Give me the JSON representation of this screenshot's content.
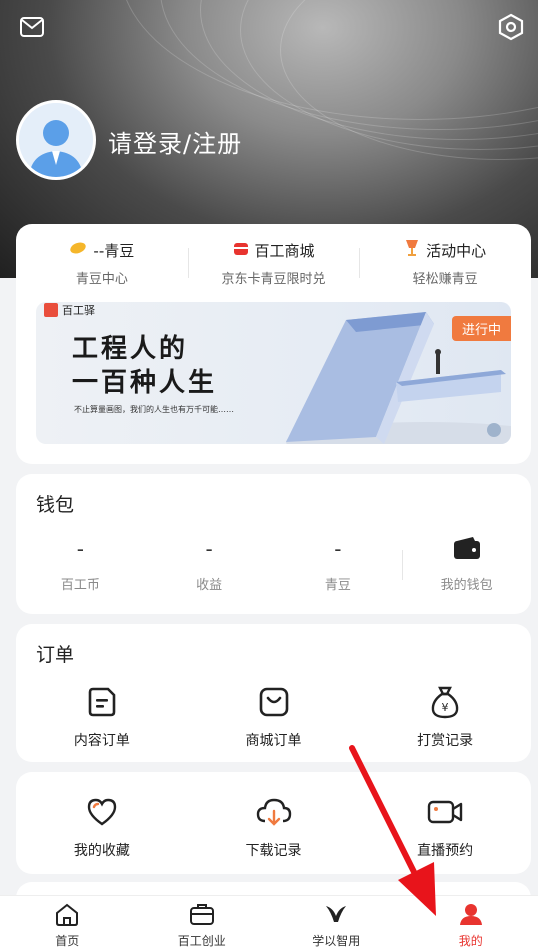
{
  "header": {
    "login_text": "请登录/注册",
    "left_icon": "mail-icon",
    "right_icon": "settings-hex-icon"
  },
  "stats": [
    {
      "title": "--青豆",
      "sub": "青豆中心",
      "icon": "bean-icon"
    },
    {
      "title": "百工商城",
      "sub": "京东卡青豆限时兑",
      "icon": "shop-icon"
    },
    {
      "title": "活动中心",
      "sub": "轻松赚青豆",
      "icon": "trophy-icon"
    }
  ],
  "banner": {
    "logo_text": "百工驿",
    "title_line1": "工程人的",
    "title_line2": "一百种人生",
    "subtitle": "不止算量画图，我们的人生也有万千可能……",
    "tag": "进行中"
  },
  "wallet": {
    "title": "钱包",
    "items": [
      {
        "value": "-",
        "label": "百工币"
      },
      {
        "value": "-",
        "label": "收益"
      },
      {
        "value": "-",
        "label": "青豆"
      }
    ],
    "my_wallet_label": "我的钱包"
  },
  "orders": {
    "title": "订单",
    "items": [
      {
        "label": "内容订单",
        "icon": "content-order-icon"
      },
      {
        "label": "商城订单",
        "icon": "shop-order-icon"
      },
      {
        "label": "打赏记录",
        "icon": "money-bag-icon"
      }
    ]
  },
  "more": {
    "items": [
      {
        "label": "我的收藏",
        "icon": "heart-icon"
      },
      {
        "label": "下载记录",
        "icon": "cloud-download-icon"
      },
      {
        "label": "直播预约",
        "icon": "video-icon"
      }
    ]
  },
  "nav": [
    {
      "label": "首页",
      "icon": "home-icon"
    },
    {
      "label": "百工创业",
      "icon": "briefcase-icon"
    },
    {
      "label": "学以智用",
      "icon": "learn-icon"
    },
    {
      "label": "我的",
      "icon": "profile-icon",
      "active": true
    }
  ],
  "colors": {
    "accent": "#e8342f",
    "tag": "#f07a3f"
  }
}
